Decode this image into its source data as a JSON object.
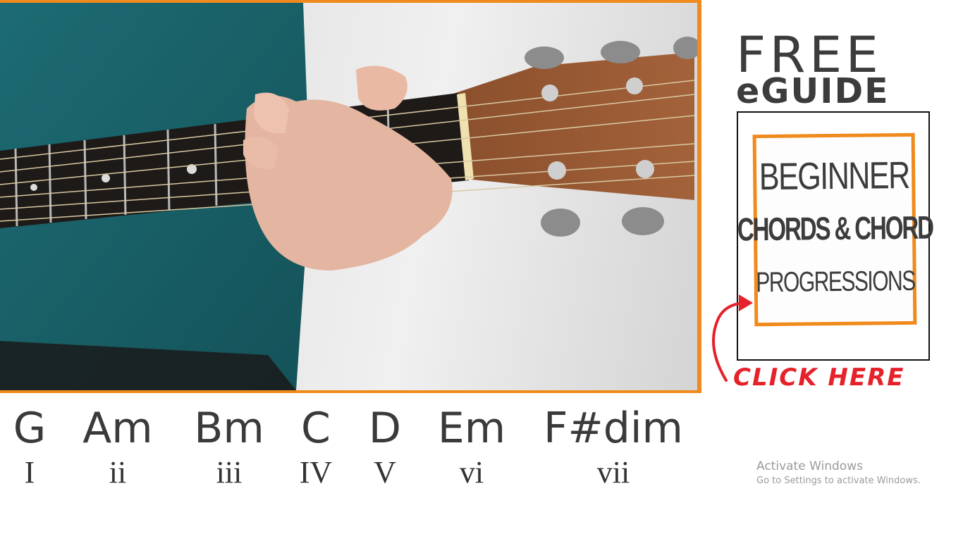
{
  "chords": [
    {
      "name": "G",
      "numeral": "I"
    },
    {
      "name": "Am",
      "numeral": "ii"
    },
    {
      "name": "Bm",
      "numeral": "iii"
    },
    {
      "name": "C",
      "numeral": "IV"
    },
    {
      "name": "D",
      "numeral": "V"
    },
    {
      "name": "Em",
      "numeral": "vi"
    },
    {
      "name": "F#dim",
      "numeral": "vii"
    }
  ],
  "ad": {
    "free_label": "FREE",
    "eguide_label": "eGUIDE",
    "cover_line_1": "BEGINNER",
    "cover_line_2": "CHORDS & CHORD",
    "cover_line_3": "PROGRESSIONS",
    "cta_label": "CLICK HERE"
  },
  "watermark": {
    "title": "Activate Windows",
    "subtitle": "Go to Settings to activate Windows."
  },
  "colors": {
    "accent_orange": "#f08a1c",
    "cta_red": "#e5212a",
    "text_dark": "#3c3c3c"
  },
  "icons": {
    "cta_arrow": "curved-arrow-icon"
  }
}
